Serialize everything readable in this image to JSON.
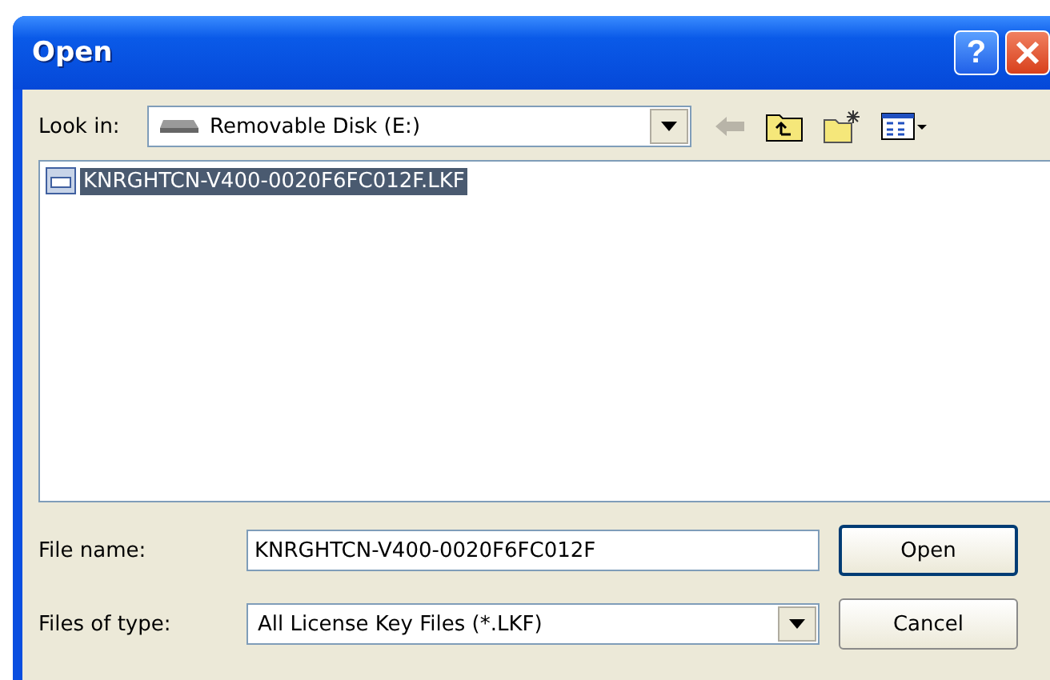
{
  "window": {
    "title": "Open",
    "buttons": [
      {
        "kind": "help",
        "label": "?"
      },
      {
        "kind": "close"
      }
    ]
  },
  "look_in": {
    "label": "Look in:",
    "value": "Removable Disk (E:)"
  },
  "files": [
    {
      "name": "KNRGHTCN-V400-0020F6FC012F.LKF",
      "selected": true
    }
  ],
  "file_name": {
    "label": "File name:",
    "value": "KNRGHTCN-V400-0020F6FC012F"
  },
  "files_of_type": {
    "label": "Files of type:",
    "value": "All License Key Files (*.LKF)"
  },
  "buttons": [
    {
      "label": "Open",
      "default": true
    },
    {
      "label": "Cancel",
      "default": false
    }
  ]
}
